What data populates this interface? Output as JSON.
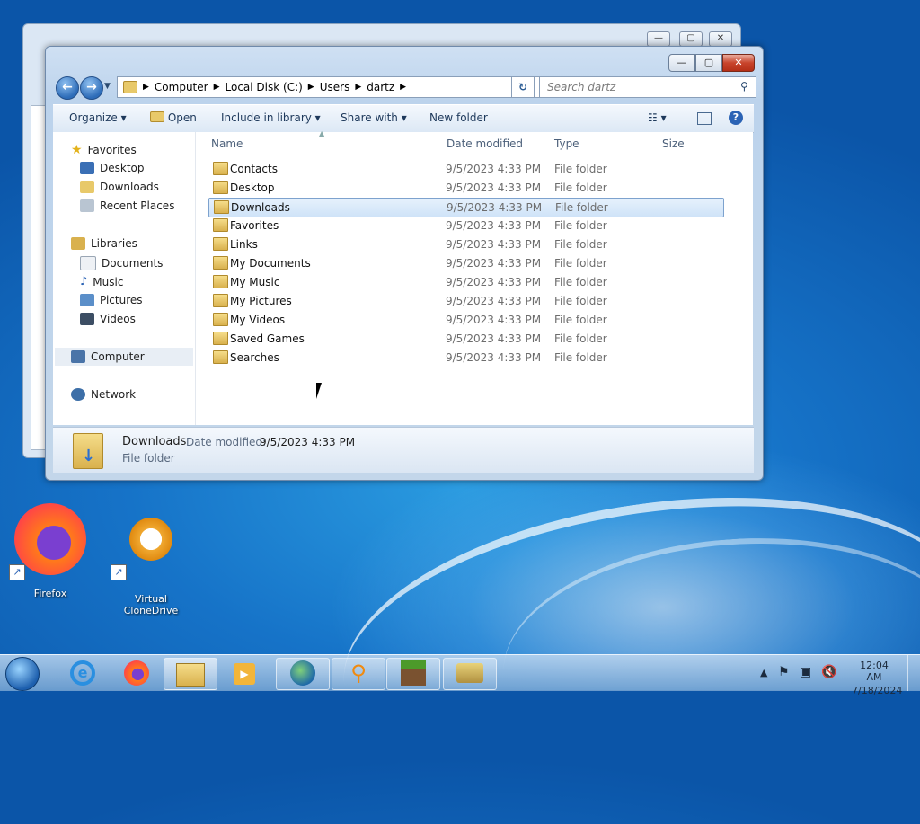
{
  "window": {
    "address": [
      "Computer",
      "Local Disk (C:)",
      "Users",
      "dartz"
    ],
    "search_placeholder": "Search dartz",
    "toolbar": {
      "organize": "Organize",
      "open": "Open",
      "include": "Include in library",
      "share": "Share with",
      "new_folder": "New folder"
    },
    "nav": {
      "favorites": "Favorites",
      "desktop": "Desktop",
      "downloads": "Downloads",
      "recent": "Recent Places",
      "libraries": "Libraries",
      "documents": "Documents",
      "music": "Music",
      "pictures": "Pictures",
      "videos": "Videos",
      "computer": "Computer",
      "network": "Network"
    },
    "columns": {
      "name": "Name",
      "date": "Date modified",
      "type": "Type",
      "size": "Size"
    },
    "files": [
      {
        "name": "Contacts",
        "date": "9/5/2023 4:33 PM",
        "type": "File folder"
      },
      {
        "name": "Desktop",
        "date": "9/5/2023 4:33 PM",
        "type": "File folder"
      },
      {
        "name": "Downloads",
        "date": "9/5/2023 4:33 PM",
        "type": "File folder"
      },
      {
        "name": "Favorites",
        "date": "9/5/2023 4:33 PM",
        "type": "File folder"
      },
      {
        "name": "Links",
        "date": "9/5/2023 4:33 PM",
        "type": "File folder"
      },
      {
        "name": "My Documents",
        "date": "9/5/2023 4:33 PM",
        "type": "File folder"
      },
      {
        "name": "My Music",
        "date": "9/5/2023 4:33 PM",
        "type": "File folder"
      },
      {
        "name": "My Pictures",
        "date": "9/5/2023 4:33 PM",
        "type": "File folder"
      },
      {
        "name": "My Videos",
        "date": "9/5/2023 4:33 PM",
        "type": "File folder"
      },
      {
        "name": "Saved Games",
        "date": "9/5/2023 4:33 PM",
        "type": "File folder"
      },
      {
        "name": "Searches",
        "date": "9/5/2023 4:33 PM",
        "type": "File folder"
      }
    ],
    "selected_index": 2,
    "details": {
      "name": "Downloads",
      "date_label": "Date modified:",
      "date": "9/5/2023 4:33 PM",
      "type": "File folder"
    }
  },
  "desktop": {
    "firefox": "Firefox",
    "clonedrive": "Virtual CloneDrive"
  },
  "tray": {
    "time": "12:04 AM",
    "date": "7/18/2024"
  }
}
